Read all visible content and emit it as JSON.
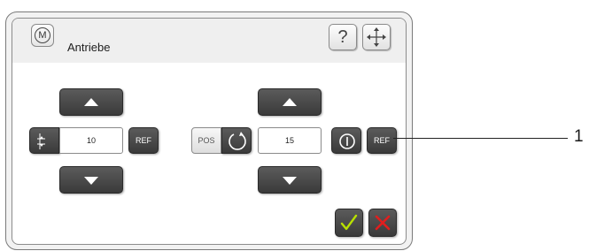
{
  "dialog": {
    "mode_icon_letter": "M",
    "title": "Antriebe",
    "help_label": "?",
    "icons": {
      "mode": "mode-m-circle-icon",
      "help": "question-mark-icon",
      "move": "move-arrows-icon",
      "length": "length-dimension-icon",
      "rotate": "rotate-circle-icon",
      "power": "power-toggle-icon",
      "ok": "checkmark-icon",
      "cancel": "x-close-icon"
    }
  },
  "left_axis": {
    "value": "10",
    "ref_label": "REF"
  },
  "right_axis": {
    "pos_label": "POS",
    "value": "15",
    "ref_label": "REF"
  },
  "callout": {
    "number": "1"
  },
  "colors": {
    "button_dark": "#3a3a3a",
    "ok_check": "#b8e000",
    "cancel_x": "#e01e1e"
  }
}
